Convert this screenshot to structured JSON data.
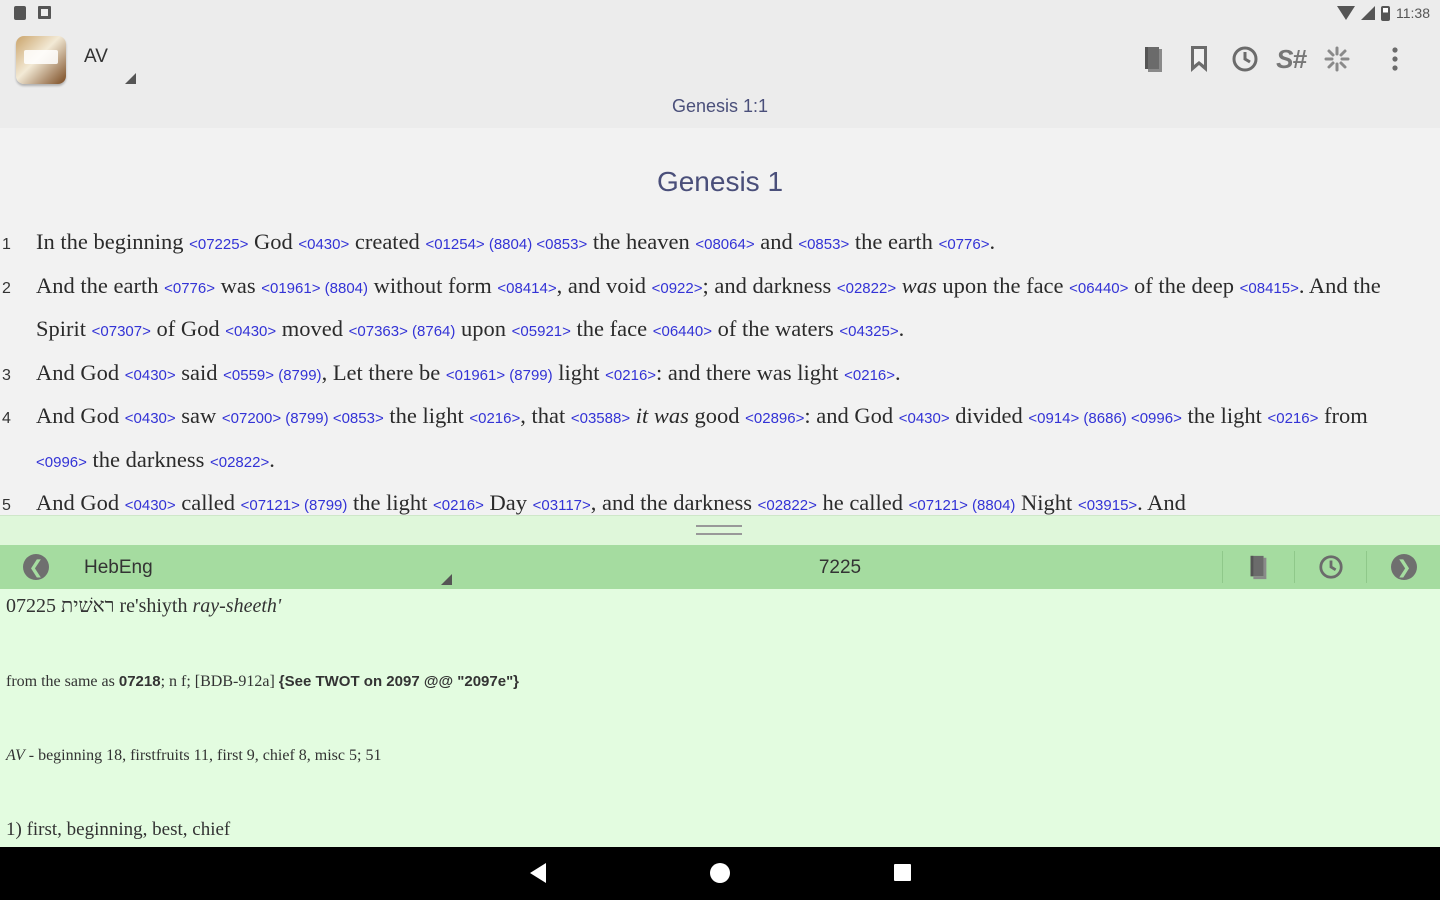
{
  "status_bar": {
    "time": "11:38"
  },
  "header": {
    "version": "AV",
    "reference": "Genesis 1:1",
    "toolbar_sn_label": "S#"
  },
  "bible": {
    "chapter_title": "Genesis 1",
    "verses": [
      {
        "number": "1",
        "segments": [
          {
            "t": "In the beginning "
          },
          {
            "s": "<07225>"
          },
          {
            "t": " God "
          },
          {
            "s": "<0430>"
          },
          {
            "t": " created "
          },
          {
            "s": "<01254> (8804) <0853>"
          },
          {
            "t": " the heaven "
          },
          {
            "s": "<08064>"
          },
          {
            "t": " and "
          },
          {
            "s": "<0853>"
          },
          {
            "t": " the earth "
          },
          {
            "s": "<0776>"
          },
          {
            "t": "."
          }
        ]
      },
      {
        "number": "2",
        "segments": [
          {
            "t": "And the earth "
          },
          {
            "s": "<0776>"
          },
          {
            "t": " was "
          },
          {
            "s": "<01961> (8804)"
          },
          {
            "t": " without form "
          },
          {
            "s": "<08414>"
          },
          {
            "t": ", and void "
          },
          {
            "s": "<0922>"
          },
          {
            "t": "; and darkness "
          },
          {
            "s": "<02822>"
          },
          {
            "t": " "
          },
          {
            "i": "was"
          },
          {
            "t": " upon the face "
          },
          {
            "s": "<06440>"
          },
          {
            "t": " of the deep "
          },
          {
            "s": "<08415>"
          },
          {
            "t": ". And the Spirit "
          },
          {
            "s": "<07307>"
          },
          {
            "t": " of God "
          },
          {
            "s": "<0430>"
          },
          {
            "t": " moved "
          },
          {
            "s": "<07363> (8764)"
          },
          {
            "t": " upon "
          },
          {
            "s": "<05921>"
          },
          {
            "t": " the face "
          },
          {
            "s": "<06440>"
          },
          {
            "t": " of the waters "
          },
          {
            "s": "<04325>"
          },
          {
            "t": "."
          }
        ]
      },
      {
        "number": "3",
        "segments": [
          {
            "t": "And God "
          },
          {
            "s": "<0430>"
          },
          {
            "t": " said "
          },
          {
            "s": "<0559> (8799)"
          },
          {
            "t": ", Let there be "
          },
          {
            "s": "<01961> (8799)"
          },
          {
            "t": " light "
          },
          {
            "s": "<0216>"
          },
          {
            "t": ": and there was light "
          },
          {
            "s": "<0216>"
          },
          {
            "t": "."
          }
        ]
      },
      {
        "number": "4",
        "segments": [
          {
            "t": "And God "
          },
          {
            "s": "<0430>"
          },
          {
            "t": " saw "
          },
          {
            "s": "<07200> (8799) <0853>"
          },
          {
            "t": " the light "
          },
          {
            "s": "<0216>"
          },
          {
            "t": ", that "
          },
          {
            "s": "<03588>"
          },
          {
            "t": " "
          },
          {
            "i": "it was"
          },
          {
            "t": " good "
          },
          {
            "s": "<02896>"
          },
          {
            "t": ": and God "
          },
          {
            "s": "<0430>"
          },
          {
            "t": " divided "
          },
          {
            "s": "<0914> (8686) <0996>"
          },
          {
            "t": " the light "
          },
          {
            "s": "<0216>"
          },
          {
            "t": " from "
          },
          {
            "s": "<0996>"
          },
          {
            "t": " the darkness "
          },
          {
            "s": "<02822>"
          },
          {
            "t": "."
          }
        ]
      },
      {
        "number": "5",
        "segments": [
          {
            "t": "And God "
          },
          {
            "s": "<0430>"
          },
          {
            "t": " called "
          },
          {
            "s": "<07121> (8799)"
          },
          {
            "t": " the light "
          },
          {
            "s": "<0216>"
          },
          {
            "t": " Day "
          },
          {
            "s": "<03117>"
          },
          {
            "t": ", and the darkness "
          },
          {
            "s": "<02822>"
          },
          {
            "t": " he called "
          },
          {
            "s": "<07121> (8804)"
          },
          {
            "t": " Night "
          },
          {
            "s": "<03915>"
          },
          {
            "t": ". And"
          }
        ]
      }
    ]
  },
  "dictionary": {
    "module": "HebEng",
    "key": "7225",
    "headword": {
      "number": "07225",
      "hebrew": "ראשׁית",
      "translit": "re'shiyth",
      "pron": "ray-sheeth'"
    },
    "derivation": {
      "text": "from the same as ",
      "ref": "07218",
      "rest": "; n f; [BDB-912a]",
      "twot": "{See TWOT on 2097 @@ \"2097e\"}"
    },
    "av_usage": {
      "prefix": "AV",
      "text": " - beginning 18, firstfruits 11, first 9, chief 8, misc 5; 51"
    },
    "definition": "1) first, beginning, best, chief"
  },
  "colors": {
    "strongs_link": "#3333d6",
    "header_accent": "#4a4f7a",
    "dict_bar": "#a5dca0",
    "dict_bg": "#e3fce0"
  },
  "icons": {
    "toolbar": [
      "book-icon",
      "bookmark-icon",
      "history-icon",
      "strongs-toggle",
      "sparkle-icon",
      "overflow-menu-icon"
    ],
    "dict_bar": [
      "back-arrow-icon",
      "book-icon",
      "history-icon",
      "forward-arrow-icon"
    ]
  }
}
